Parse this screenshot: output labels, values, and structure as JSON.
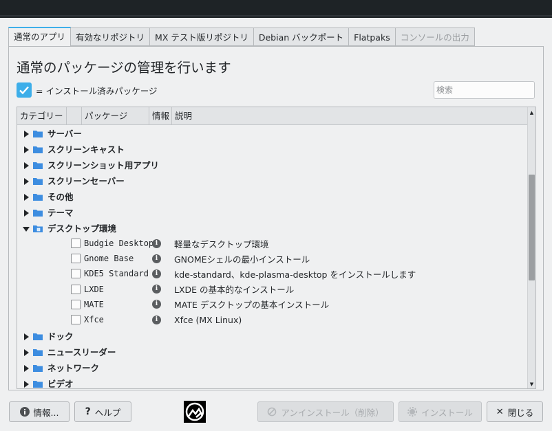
{
  "tabs": [
    {
      "label": "通常のアプリ",
      "active": true
    },
    {
      "label": "有効なリポジトリ"
    },
    {
      "label": "MX テスト版リポジトリ"
    },
    {
      "label": "Debian バックポート"
    },
    {
      "label": "Flatpaks"
    },
    {
      "label": "コンソールの出力",
      "disabled": true
    }
  ],
  "heading": "通常のパッケージの管理を行います",
  "legend": {
    "text": "= インストール済みパッケージ",
    "checked": true
  },
  "search": {
    "placeholder": "検索",
    "value": ""
  },
  "columns": [
    "カテゴリー",
    "パッケージ",
    "情報",
    "説明"
  ],
  "categories_before": [
    "サーバー",
    "スクリーンキャスト",
    "スクリーンショット用アプリ",
    "スクリーンセーバー",
    "その他",
    "テーマ"
  ],
  "expanded_category": "デスクトップ環境",
  "packages": [
    {
      "name": "Budgie Desktop",
      "desc": "軽量なデスクトップ環境"
    },
    {
      "name": "Gnome Base",
      "desc": "GNOMEシェルの最小インストール"
    },
    {
      "name": "KDE5 Standard",
      "desc": "kde-standard、kde-plasma-desktop をインストールします"
    },
    {
      "name": "LXDE",
      "desc": "LXDE の基本的なインストール"
    },
    {
      "name": "MATE",
      "desc": "MATE デスクトップの基本インストール"
    },
    {
      "name": "Xfce",
      "desc": "Xfce (MX Linux)"
    }
  ],
  "categories_after": [
    "ドック",
    "ニュースリーダー",
    "ネットワーク",
    "ビデオ"
  ],
  "buttons": {
    "info": "情報...",
    "help": "ヘルプ",
    "uninstall": "アンインストール（削除）",
    "install": "インストール",
    "close": "閉じる"
  },
  "colors": {
    "accent": "#3daee9",
    "folder": "#3d8de0"
  }
}
